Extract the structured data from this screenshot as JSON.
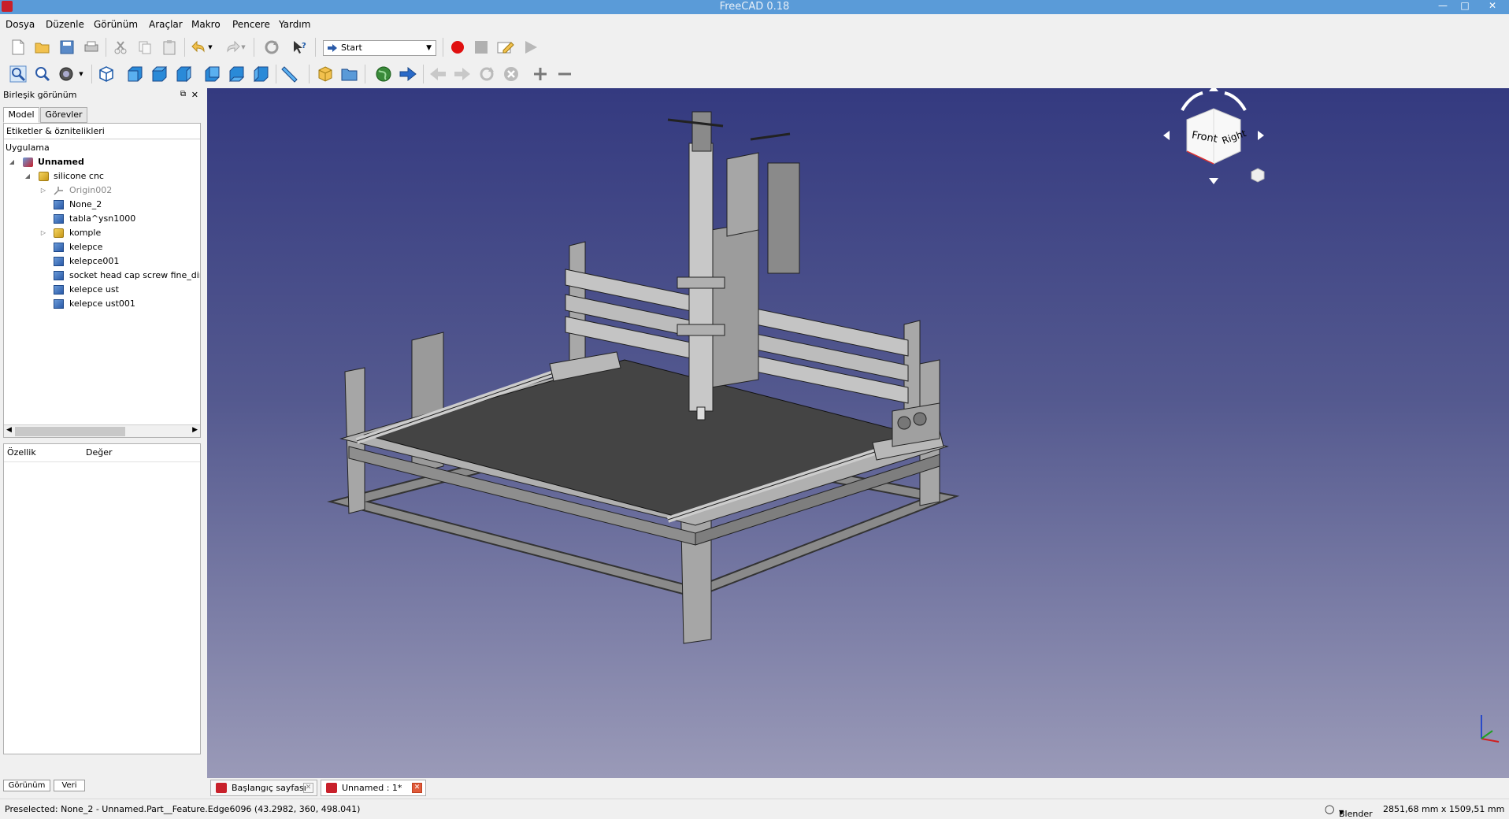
{
  "window": {
    "title": "FreeCAD 0.18",
    "minimize": "—",
    "maximize": "□",
    "close": "✕"
  },
  "menu": [
    "Dosya",
    "Düzenle",
    "Görünüm",
    "Araçlar",
    "Makro",
    "Pencere",
    "Yardım"
  ],
  "toolbar": {
    "workbench": "Start"
  },
  "combo_view": {
    "title": "Birleşik görünüm",
    "tabs": [
      "Model",
      "Görevler"
    ],
    "tree_header": "Etiketler & öznitelikleri",
    "tree": [
      {
        "label": "Uygulama",
        "icon": "none",
        "toggle": "",
        "bold": false,
        "dim": false
      },
      {
        "label": "Unnamed",
        "icon": "document-icon",
        "toggle": "◢",
        "bold": true,
        "dim": false
      },
      {
        "label": "silicone cnc",
        "icon": "part-icon",
        "toggle": "◢",
        "bold": false,
        "dim": false
      },
      {
        "label": "Origin002",
        "icon": "origin-icon",
        "toggle": "▷",
        "bold": false,
        "dim": true
      },
      {
        "label": "None_2",
        "icon": "solid-icon",
        "toggle": "",
        "bold": false,
        "dim": false
      },
      {
        "label": "tabla^ysn1000",
        "icon": "solid-icon",
        "toggle": "",
        "bold": false,
        "dim": false
      },
      {
        "label": "komple",
        "icon": "part-icon",
        "toggle": "▷",
        "bold": false,
        "dim": false
      },
      {
        "label": "kelepce",
        "icon": "solid-icon",
        "toggle": "",
        "bold": false,
        "dim": false
      },
      {
        "label": "kelepce001",
        "icon": "solid-icon",
        "toggle": "",
        "bold": false,
        "dim": false
      },
      {
        "label": "socket head cap screw fine_din_",
        "icon": "solid-icon",
        "toggle": "",
        "bold": false,
        "dim": false
      },
      {
        "label": "kelepce ust",
        "icon": "solid-icon",
        "toggle": "",
        "bold": false,
        "dim": false
      },
      {
        "label": "kelepce ust001",
        "icon": "solid-icon",
        "toggle": "",
        "bold": false,
        "dim": false
      }
    ],
    "property_headers": [
      "Özellik",
      "Değer"
    ],
    "bottom_tabs": [
      "Görünüm",
      "Veri"
    ]
  },
  "navcube": {
    "front": "Front",
    "right": "Right"
  },
  "doc_tabs": [
    {
      "label": "Başlangıç sayfası",
      "active": false
    },
    {
      "label": "Unnamed : 1*",
      "active": true
    }
  ],
  "status": {
    "preselection": "Preselected: None_2 - Unnamed.Part__Feature.Edge6096 (43.2982, 360, 498.041)",
    "nav_style": "Blender",
    "dimensions": "2851,68 mm x 1509,51 mm"
  }
}
